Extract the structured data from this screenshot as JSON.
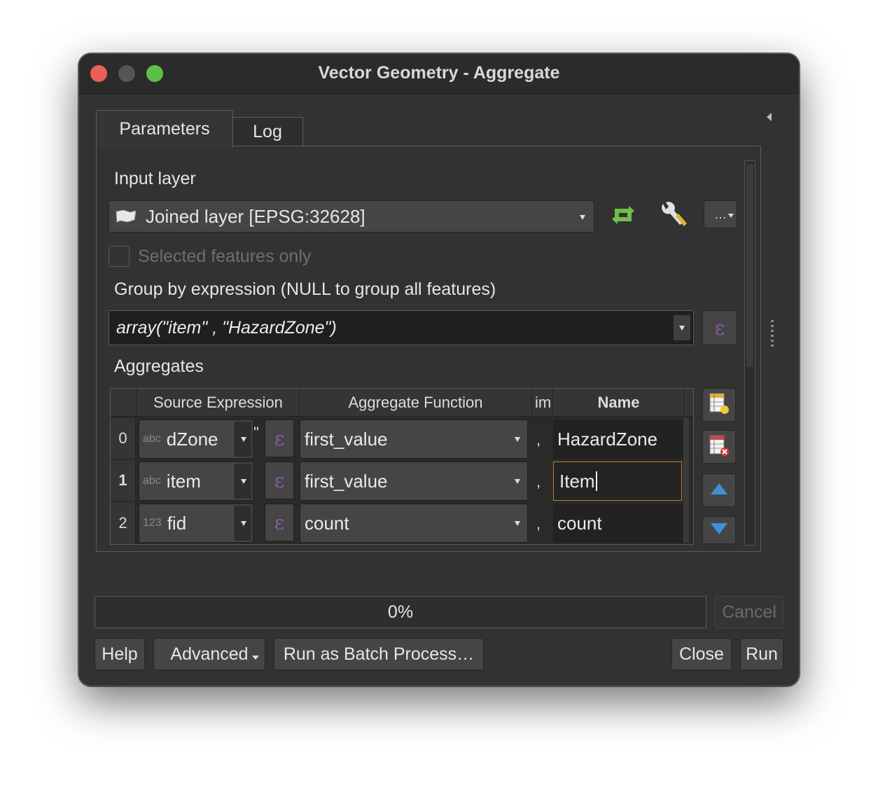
{
  "window": {
    "title": "Vector Geometry - Aggregate"
  },
  "tabs": [
    {
      "label": "Parameters",
      "active": true
    },
    {
      "label": "Log",
      "active": false
    }
  ],
  "input_layer": {
    "label": "Input layer",
    "value": "Joined layer [EPSG:32628]",
    "icon": "polygon-layer-icon",
    "options_button": "…"
  },
  "selected_only": {
    "label": "Selected features only",
    "checked": false,
    "enabled": false
  },
  "group_by": {
    "label": "Group by expression (NULL to group all features)",
    "value": "array(\"item\" , \"HazardZone\")"
  },
  "aggregates": {
    "label": "Aggregates",
    "columns": [
      "Source Expression",
      "Aggregate Function",
      "im",
      "Name"
    ],
    "rows": [
      {
        "index": "0",
        "type": "abc",
        "source": "dZone",
        "quote": "\"",
        "function": "first_value",
        "sep": ",",
        "name": "HazardZone"
      },
      {
        "index": "1",
        "type": "abc",
        "source": "item",
        "quote": "",
        "function": "first_value",
        "sep": ",",
        "name": "Item"
      },
      {
        "index": "2",
        "type": "123",
        "source": "fid",
        "quote": "",
        "function": "count",
        "sep": ",",
        "name": "count"
      }
    ]
  },
  "progress": {
    "value": 0.0,
    "text": "0%"
  },
  "buttons": {
    "cancel": "Cancel",
    "help": "Help",
    "advanced": "Advanced",
    "batch": "Run as Batch Process…",
    "close": "Close",
    "run": "Run"
  },
  "colors": {
    "window_bg": "#323232",
    "titlebar_bg": "#2b2b2b",
    "close": "#ec5f56",
    "maximize": "#5bc146",
    "edit_focus": "#b8832a",
    "expression_epsilon": "#8a5aa8",
    "arrow_blue": "#3f8fd8"
  }
}
